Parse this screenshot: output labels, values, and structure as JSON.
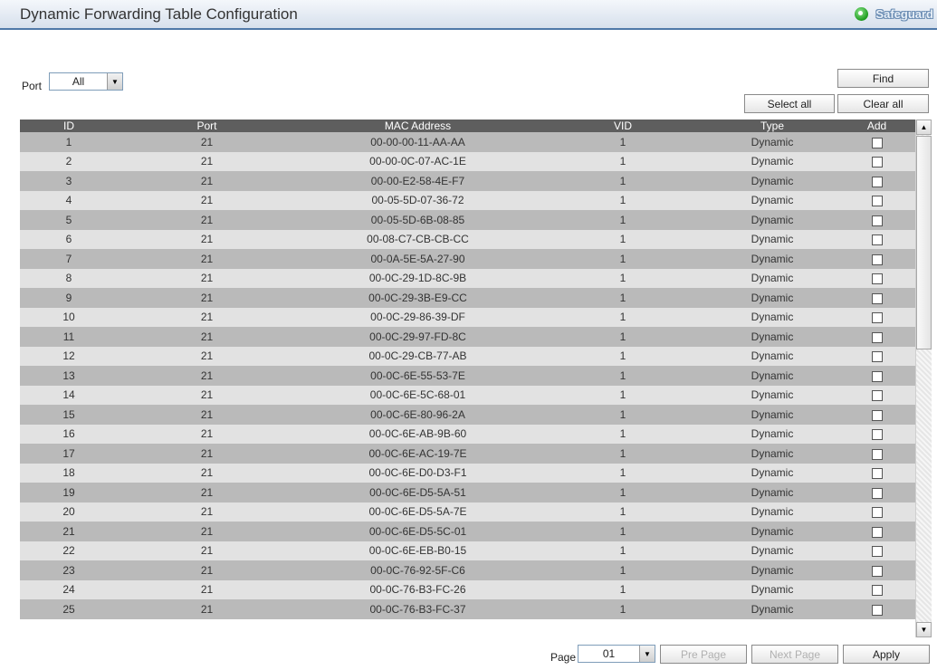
{
  "header": {
    "title": "Dynamic Forwarding Table Configuration",
    "safeguard_label": "Safeguard"
  },
  "filter": {
    "port_label": "Port",
    "port_value": "All",
    "find_label": "Find",
    "select_all_label": "Select all",
    "clear_all_label": "Clear all"
  },
  "table": {
    "columns": [
      "ID",
      "Port",
      "MAC Address",
      "VID",
      "Type",
      "Add"
    ],
    "rows": [
      {
        "id": "1",
        "port": "21",
        "mac": "00-00-00-11-AA-AA",
        "vid": "1",
        "type": "Dynamic"
      },
      {
        "id": "2",
        "port": "21",
        "mac": "00-00-0C-07-AC-1E",
        "vid": "1",
        "type": "Dynamic"
      },
      {
        "id": "3",
        "port": "21",
        "mac": "00-00-E2-58-4E-F7",
        "vid": "1",
        "type": "Dynamic"
      },
      {
        "id": "4",
        "port": "21",
        "mac": "00-05-5D-07-36-72",
        "vid": "1",
        "type": "Dynamic"
      },
      {
        "id": "5",
        "port": "21",
        "mac": "00-05-5D-6B-08-85",
        "vid": "1",
        "type": "Dynamic"
      },
      {
        "id": "6",
        "port": "21",
        "mac": "00-08-C7-CB-CB-CC",
        "vid": "1",
        "type": "Dynamic"
      },
      {
        "id": "7",
        "port": "21",
        "mac": "00-0A-5E-5A-27-90",
        "vid": "1",
        "type": "Dynamic"
      },
      {
        "id": "8",
        "port": "21",
        "mac": "00-0C-29-1D-8C-9B",
        "vid": "1",
        "type": "Dynamic"
      },
      {
        "id": "9",
        "port": "21",
        "mac": "00-0C-29-3B-E9-CC",
        "vid": "1",
        "type": "Dynamic"
      },
      {
        "id": "10",
        "port": "21",
        "mac": "00-0C-29-86-39-DF",
        "vid": "1",
        "type": "Dynamic"
      },
      {
        "id": "11",
        "port": "21",
        "mac": "00-0C-29-97-FD-8C",
        "vid": "1",
        "type": "Dynamic"
      },
      {
        "id": "12",
        "port": "21",
        "mac": "00-0C-29-CB-77-AB",
        "vid": "1",
        "type": "Dynamic"
      },
      {
        "id": "13",
        "port": "21",
        "mac": "00-0C-6E-55-53-7E",
        "vid": "1",
        "type": "Dynamic"
      },
      {
        "id": "14",
        "port": "21",
        "mac": "00-0C-6E-5C-68-01",
        "vid": "1",
        "type": "Dynamic"
      },
      {
        "id": "15",
        "port": "21",
        "mac": "00-0C-6E-80-96-2A",
        "vid": "1",
        "type": "Dynamic"
      },
      {
        "id": "16",
        "port": "21",
        "mac": "00-0C-6E-AB-9B-60",
        "vid": "1",
        "type": "Dynamic"
      },
      {
        "id": "17",
        "port": "21",
        "mac": "00-0C-6E-AC-19-7E",
        "vid": "1",
        "type": "Dynamic"
      },
      {
        "id": "18",
        "port": "21",
        "mac": "00-0C-6E-D0-D3-F1",
        "vid": "1",
        "type": "Dynamic"
      },
      {
        "id": "19",
        "port": "21",
        "mac": "00-0C-6E-D5-5A-51",
        "vid": "1",
        "type": "Dynamic"
      },
      {
        "id": "20",
        "port": "21",
        "mac": "00-0C-6E-D5-5A-7E",
        "vid": "1",
        "type": "Dynamic"
      },
      {
        "id": "21",
        "port": "21",
        "mac": "00-0C-6E-D5-5C-01",
        "vid": "1",
        "type": "Dynamic"
      },
      {
        "id": "22",
        "port": "21",
        "mac": "00-0C-6E-EB-B0-15",
        "vid": "1",
        "type": "Dynamic"
      },
      {
        "id": "23",
        "port": "21",
        "mac": "00-0C-76-92-5F-C6",
        "vid": "1",
        "type": "Dynamic"
      },
      {
        "id": "24",
        "port": "21",
        "mac": "00-0C-76-B3-FC-26",
        "vid": "1",
        "type": "Dynamic"
      },
      {
        "id": "25",
        "port": "21",
        "mac": "00-0C-76-B3-FC-37",
        "vid": "1",
        "type": "Dynamic"
      }
    ]
  },
  "pagination": {
    "page_label": "Page",
    "page_value": "01",
    "pre_page_label": "Pre Page",
    "next_page_label": "Next Page",
    "apply_label": "Apply"
  },
  "colors": {
    "header_row_bg": "#5e5e5e",
    "row_odd_bg": "#bababa",
    "row_even_bg": "#e2e2e2",
    "title_border": "#4f78a8",
    "safeguard_icon": "#1d9b1d"
  },
  "icons": {
    "safeguard": "safeguard-status-icon",
    "dropdown": "chevron-down-icon",
    "scroll_up": "scroll-up-arrow-icon",
    "scroll_down": "scroll-down-arrow-icon"
  }
}
